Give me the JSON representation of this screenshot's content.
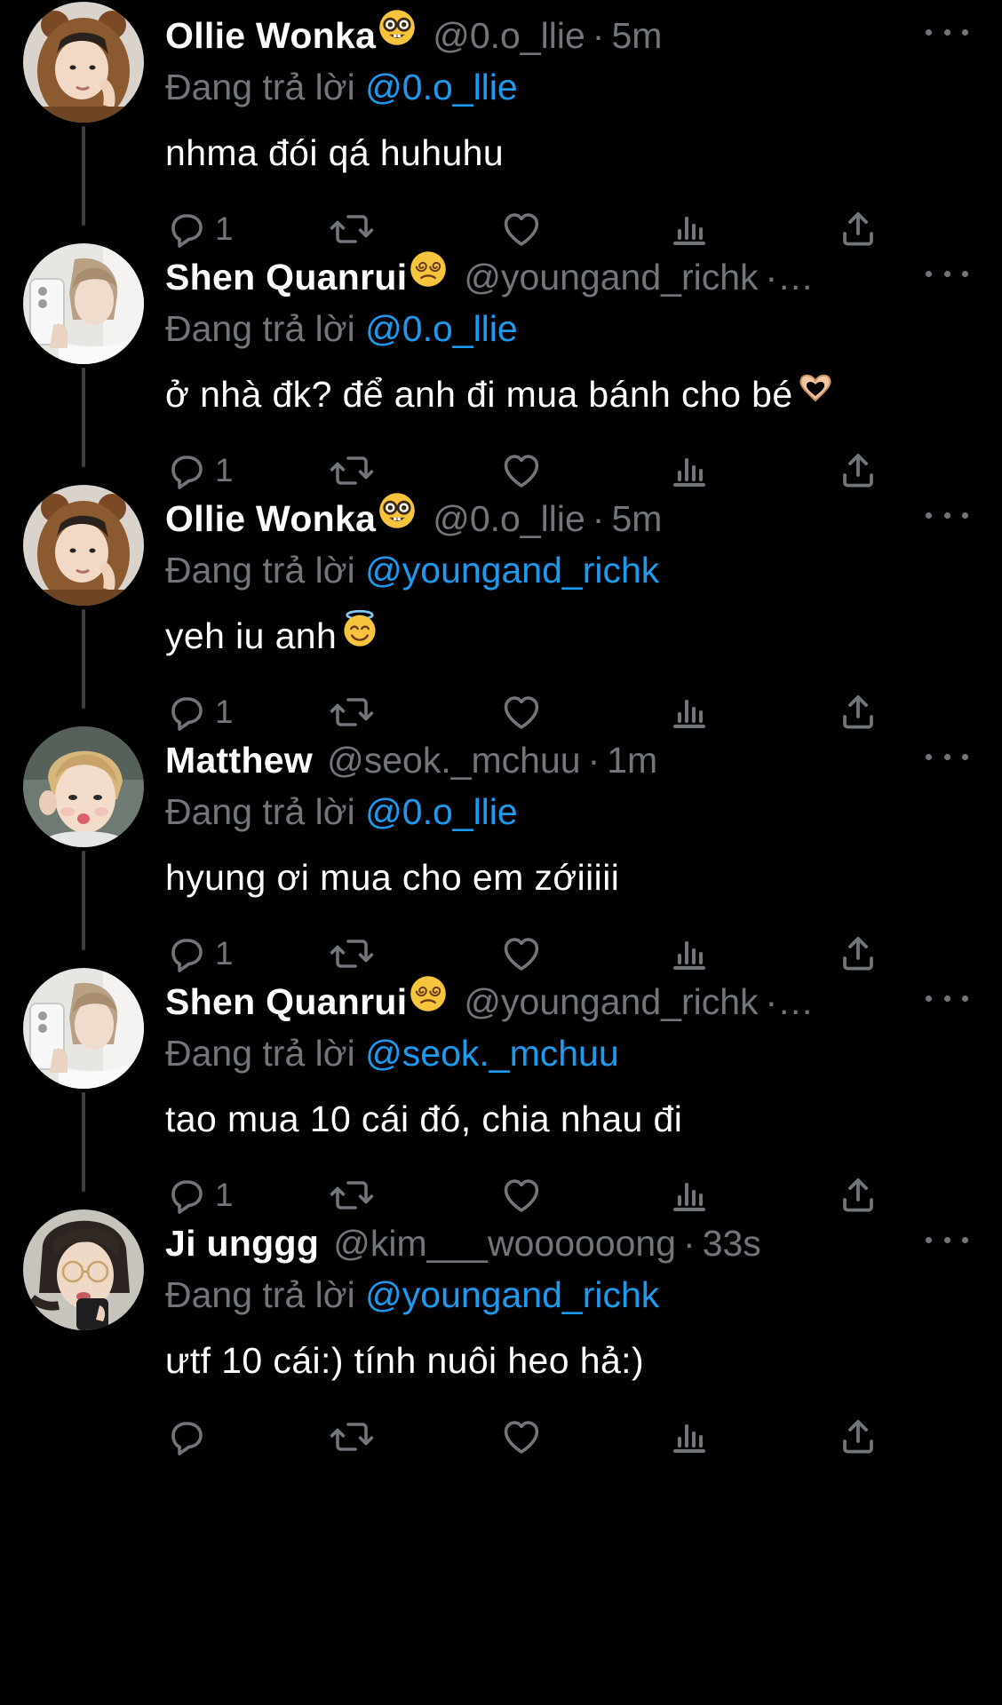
{
  "thread": [
    {
      "display_name": "Ollie Wonka",
      "name_emoji": "nerd-face-emoji",
      "handle": "@0.o_llie",
      "separator": "·",
      "time": "5m",
      "reply_prefix": "Đang trả lời",
      "reply_to": "@0.o_llie",
      "text": "nhma đói qá huhuhu",
      "text_emoji": "",
      "reply_count": "1",
      "avatar": "avatar-bear-hood"
    },
    {
      "display_name": "Shen Quanrui",
      "name_emoji": "dizzy-face-emoji",
      "handle": "@youngand_richk",
      "separator": "·…",
      "time": "",
      "reply_prefix": "Đang trả lời",
      "reply_to": "@0.o_llie",
      "text": "ở nhà đk? để anh đi mua bánh cho bé",
      "text_emoji": "heart-hands-emoji",
      "reply_count": "1",
      "avatar": "avatar-phone-selfie"
    },
    {
      "display_name": "Ollie Wonka",
      "name_emoji": "nerd-face-emoji",
      "handle": "@0.o_llie",
      "separator": "·",
      "time": "5m",
      "reply_prefix": "Đang trả lời",
      "reply_to": "@youngand_richk",
      "text": "yeh iu anh",
      "text_emoji": "halo-face-emoji",
      "reply_count": "1",
      "avatar": "avatar-bear-hood"
    },
    {
      "display_name": "Matthew",
      "name_emoji": "",
      "handle": "@seok._mchuu",
      "separator": "·",
      "time": "1m",
      "reply_prefix": "Đang trả lời",
      "reply_to": "@0.o_llie",
      "text": "hyung ơi mua cho em zớiiiii",
      "text_emoji": "",
      "reply_count": "1",
      "avatar": "avatar-pout"
    },
    {
      "display_name": "Shen Quanrui",
      "name_emoji": "dizzy-face-emoji",
      "handle": "@youngand_richk",
      "separator": "·…",
      "time": "",
      "reply_prefix": "Đang trả lời",
      "reply_to": "@seok._mchuu",
      "text": "tao mua 10 cái đó, chia nhau đi",
      "text_emoji": "",
      "reply_count": "1",
      "avatar": "avatar-phone-selfie"
    },
    {
      "display_name": "Ji unggg",
      "name_emoji": "",
      "handle": "@kim___woooooong",
      "separator": "·",
      "time": "33s",
      "reply_prefix": "Đang trả lời",
      "reply_to": "@youngand_richk",
      "text": "ưtf 10 cái:) tính nuôi heo hả:)",
      "text_emoji": "",
      "reply_count": "",
      "avatar": "avatar-glasses"
    }
  ],
  "colors": {
    "background": "#000000",
    "primary_text": "#ffffff",
    "secondary_text": "#71767b",
    "link": "#1d9bf0",
    "thread_line": "#3e4144"
  },
  "icons": {
    "reply": "reply-icon",
    "retweet": "retweet-icon",
    "like": "heart-icon",
    "views": "views-icon",
    "share": "share-icon",
    "more": "more-icon"
  }
}
